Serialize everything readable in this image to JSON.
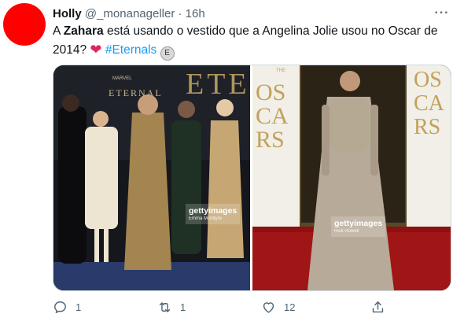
{
  "author": {
    "name": "Holly",
    "handle": "@_monanageller",
    "separator": "·",
    "time": "16h"
  },
  "more_label": "···",
  "tweet": {
    "text_prefix": "A ",
    "text_bold": "Zahara",
    "text_main": " está usando o vestido que a Angelina Jolie usou no Oscar de 2014? ",
    "heart": "❤",
    "hashtag": "#Eternals",
    "hashtag_emoji": "E"
  },
  "media": {
    "left": {
      "poster_text": "ETERNAL",
      "poster_letters": "ETE",
      "poster_small": "MARVEL",
      "watermark_brand": "gettyimages",
      "watermark_credit": "Emma McIntyre"
    },
    "right": {
      "banner_left": "OSCARS",
      "banner_left_small": "THE",
      "banner_right": "OSCARS",
      "watermark_brand": "gettyimages",
      "watermark_credit": "Rick Rowell"
    }
  },
  "actions": {
    "reply_count": "1",
    "retweet_count": "1",
    "like_count": "12"
  },
  "icons": {
    "reply": "reply-icon",
    "retweet": "retweet-icon",
    "like": "heart-icon",
    "share": "share-icon"
  },
  "colors": {
    "avatar": "#ff0000",
    "hashtag": "#1d9bf0",
    "heart": "#e0245e",
    "muted": "#536471",
    "text": "#0f1419"
  }
}
